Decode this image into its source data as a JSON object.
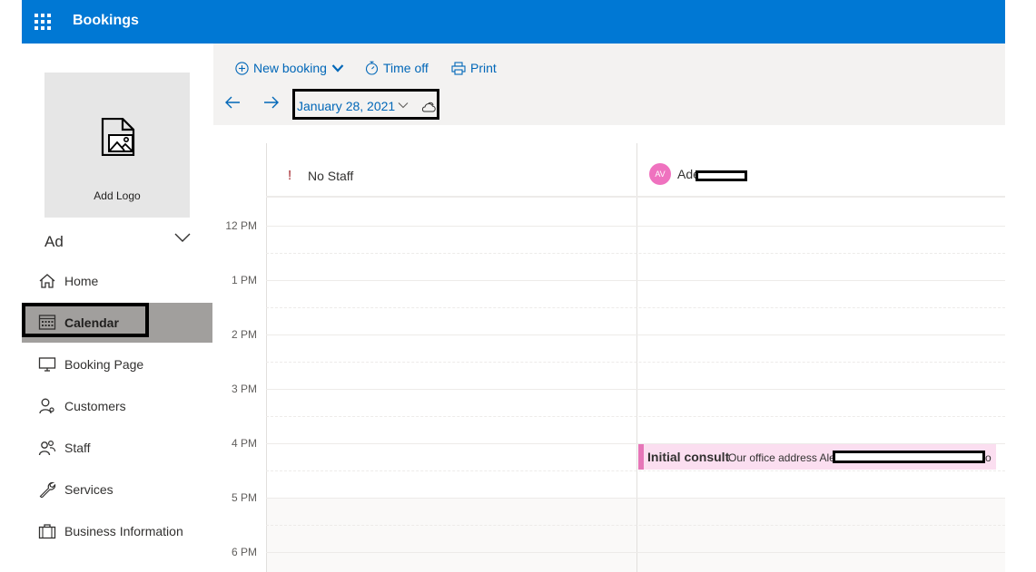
{
  "app": {
    "title": "Bookings"
  },
  "sidebar": {
    "logo_label": "Add Logo",
    "business_name": "Ad",
    "items": [
      {
        "label": "Home",
        "icon": "home-icon"
      },
      {
        "label": "Calendar",
        "icon": "calendar-icon",
        "active": true
      },
      {
        "label": "Booking Page",
        "icon": "monitor-icon"
      },
      {
        "label": "Customers",
        "icon": "person-icon"
      },
      {
        "label": "Staff",
        "icon": "people-icon"
      },
      {
        "label": "Services",
        "icon": "wrench-icon"
      },
      {
        "label": "Business Information",
        "icon": "briefcase-icon"
      }
    ]
  },
  "toolbar": {
    "new_booking": "New booking",
    "time_off": "Time off",
    "print": "Print",
    "date": "January 28, 2021"
  },
  "calendar": {
    "columns": [
      {
        "label": "No Staff",
        "indicator": "!"
      },
      {
        "label": "Ade",
        "avatar_initials": "AV"
      }
    ],
    "hours": [
      "12 PM",
      "1 PM",
      "2 PM",
      "3 PM",
      "4 PM",
      "5 PM",
      "6 PM"
    ],
    "event": {
      "title": "Initial consult",
      "location": "Our office address Ale",
      "trailing": "o"
    }
  },
  "colors": {
    "topbar": "#0078d4",
    "link": "#0067b8",
    "active_nav": "#a19f9d",
    "event_bg": "#fbdef0",
    "event_accent": "#e676b8",
    "no_staff_indicator": "#a4262c"
  }
}
